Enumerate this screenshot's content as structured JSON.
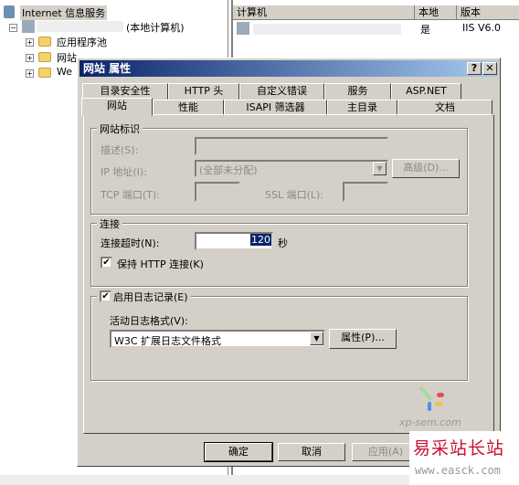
{
  "tree": {
    "root": "Internet 信息服务",
    "computer": "(本地计算机)",
    "items": [
      "应用程序池",
      "网站",
      "We"
    ]
  },
  "list": {
    "columns": [
      "计算机",
      "本地",
      "版本"
    ],
    "row": {
      "local": "是",
      "version": "IIS V6.0"
    }
  },
  "dialog": {
    "title": "网站 属性",
    "help": "?",
    "close": "✕",
    "tabs_row1": [
      "目录安全性",
      "HTTP 头",
      "自定义错误",
      "服务",
      "ASP.NET"
    ],
    "tabs_row2": [
      "网站",
      "性能",
      "ISAPI 筛选器",
      "主目录",
      "文档"
    ],
    "identity": {
      "legend": "网站标识",
      "desc_label": "描述(S):",
      "ip_label": "IP 地址(I):",
      "ip_value": "(全部未分配)",
      "advanced": "高级(D)...",
      "tcp_label": "TCP 端口(T):",
      "ssl_label": "SSL 端口(L):"
    },
    "connection": {
      "legend": "连接",
      "timeout_label": "连接超时(N):",
      "timeout_value": "120",
      "unit": "秒",
      "keepalive_label": "保持 HTTP 连接(K)",
      "keepalive_checked": true
    },
    "logging": {
      "legend": "启用日志记录(E)",
      "checked": true,
      "format_label": "活动日志格式(V):",
      "format_value": "W3C 扩展日志文件格式",
      "properties": "属性(P)..."
    },
    "buttons": {
      "ok": "确定",
      "cancel": "取消",
      "apply": "应用(A)"
    }
  },
  "watermarks": {
    "xpsem": "xp-sem.com",
    "site": "易采站长站",
    "url": "www.easck.com"
  }
}
